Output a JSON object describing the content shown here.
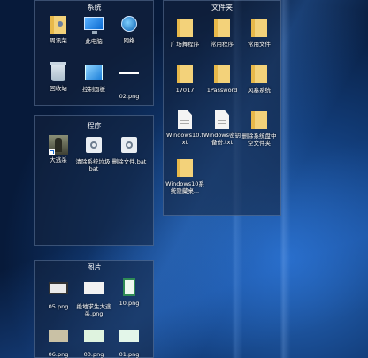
{
  "fences": {
    "system": {
      "title": "系统",
      "items": [
        "回收站（此行不显示）"
      ]
    }
  },
  "system": {
    "title": "系统",
    "items": [
      {
        "label": "周讯荣",
        "icon": "user-folder-icon"
      },
      {
        "label": "此电脑",
        "icon": "computer-icon"
      },
      {
        "label": "网络",
        "icon": "network-icon"
      },
      {
        "label": "回收站",
        "icon": "recycle-bin-icon"
      },
      {
        "label": "控制面板",
        "icon": "control-panel-icon"
      },
      {
        "label": "02.png",
        "icon": "image-icon"
      }
    ]
  },
  "programs": {
    "title": "程序",
    "items": [
      {
        "label": "大逃杀",
        "icon": "game-shortcut-icon"
      },
      {
        "label": "清除系统垃圾.bat",
        "icon": "batch-file-icon"
      },
      {
        "label": "删除文件.bat",
        "icon": "batch-file-icon"
      }
    ]
  },
  "folders": {
    "title": "文件夹",
    "items": [
      {
        "label": "广场舞程序",
        "icon": "folder-icon"
      },
      {
        "label": "常用程序",
        "icon": "folder-icon"
      },
      {
        "label": "常用文件",
        "icon": "folder-icon"
      },
      {
        "label": "17017",
        "icon": "folder-icon"
      },
      {
        "label": "1Password",
        "icon": "folder-icon"
      },
      {
        "label": "风塞系统",
        "icon": "folder-icon"
      },
      {
        "label": "Windows10.txt",
        "icon": "text-file-icon"
      },
      {
        "label": "Windows密钥备份.txt",
        "icon": "text-file-icon"
      },
      {
        "label": "删除系统盘中空文件夹",
        "icon": "folder-icon"
      },
      {
        "label": "Windows10系统隐藏桌...",
        "icon": "folder-icon"
      }
    ]
  },
  "pictures": {
    "title": "图片",
    "items": [
      {
        "label": "05.png",
        "icon": "image-icon"
      },
      {
        "label": "绝地求生大逃杀.png",
        "icon": "image-icon"
      },
      {
        "label": "10.png",
        "icon": "image-icon"
      },
      {
        "label": "06.png",
        "icon": "image-icon"
      },
      {
        "label": "00.png",
        "icon": "image-icon"
      },
      {
        "label": "01.png",
        "icon": "image-icon"
      }
    ]
  },
  "colors": {
    "folder": "#f3d27a",
    "fence_bg": "#14233c",
    "wallpaper": "#0a1f44"
  }
}
